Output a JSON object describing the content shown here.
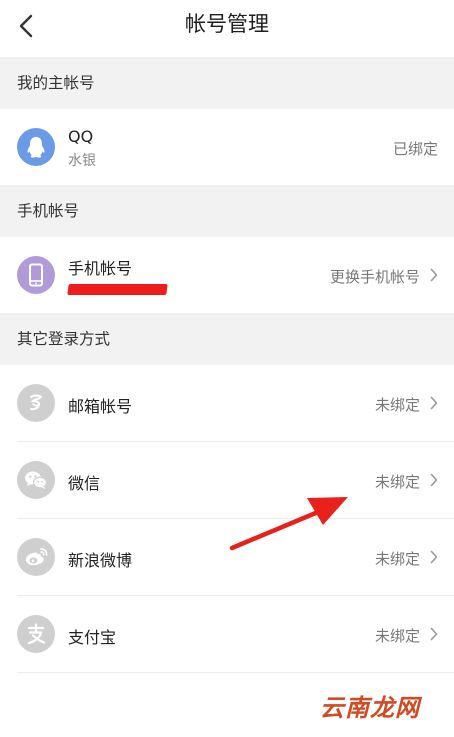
{
  "header": {
    "title": "帐号管理",
    "back_icon": "chevron-left-icon"
  },
  "sections": {
    "main_account": {
      "title": "我的主帐号",
      "item": {
        "name": "QQ",
        "nickname": "水银",
        "status": "已绑定",
        "icon": "qq-penguin-icon",
        "icon_color": "#6b9be6"
      }
    },
    "phone_account": {
      "title": "手机帐号",
      "item": {
        "name": "手机帐号",
        "action": "更换手机帐号",
        "icon": "mobile-phone-icon",
        "icon_color": "#b19ad9",
        "redaction_color": "#ee1c1c"
      }
    },
    "other_login": {
      "title": "其它登录方式",
      "items": [
        {
          "name": "邮箱帐号",
          "status": "未绑定",
          "icon": "email-logo-icon"
        },
        {
          "name": "微信",
          "status": "未绑定",
          "icon": "wechat-icon"
        },
        {
          "name": "新浪微博",
          "status": "未绑定",
          "icon": "weibo-icon"
        },
        {
          "name": "支付宝",
          "status": "未绑定",
          "icon": "alipay-icon"
        }
      ],
      "icon_color": "#cfcfcf"
    }
  },
  "annotation": {
    "arrow_color": "#e8211a"
  },
  "watermark": {
    "text": "云南龙网"
  }
}
